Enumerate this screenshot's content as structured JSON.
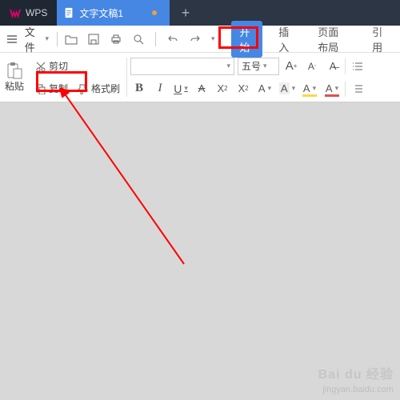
{
  "titlebar": {
    "app": "WPS",
    "tab_title": "文字文稿1"
  },
  "menubar": {
    "file": "文件",
    "tabs": {
      "start": "开始",
      "insert": "插入",
      "layout": "页面布局",
      "reference": "引用"
    }
  },
  "ribbon": {
    "paste": "粘贴",
    "cut": "剪切",
    "copy": "复制",
    "format_painter": "格式刷",
    "font_size": "五号",
    "bold": "B",
    "italic": "I",
    "underline": "U",
    "strike": "A",
    "sup": "X²",
    "sub": "X₂",
    "clear": "A",
    "textfx": "A",
    "highlight": "A",
    "fontcolor": "A",
    "list_icon": ""
  },
  "watermark": {
    "brand": "Bai du 经验",
    "url": "jingyan.baidu.com"
  },
  "colors": {
    "accent": "#4687e4",
    "red": "#ff0000",
    "highlight_bar": "#ffd54a",
    "font_bar": "#d9534f"
  }
}
